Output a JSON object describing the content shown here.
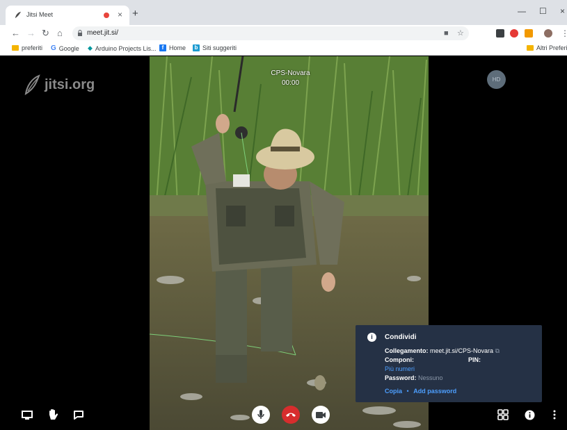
{
  "browser": {
    "tab_title": "Jitsi Meet",
    "close_glyph": "×",
    "new_tab_glyph": "+",
    "window_controls": {
      "minimize": "—",
      "maximize": "☐",
      "close": "×"
    },
    "url": "meet.jit.si/",
    "bookmarks": [
      {
        "label": "preferiti",
        "icon": "folder-icon"
      },
      {
        "label": "Google",
        "icon": "google-icon"
      },
      {
        "label": "Arduino Projects Lis...",
        "icon": "arduino-icon"
      },
      {
        "label": "Home",
        "icon": "facebook-icon"
      },
      {
        "label": "Siti suggeriti",
        "icon": "bing-icon"
      }
    ],
    "other_bookmarks": "Altri Preferiti"
  },
  "meeting": {
    "logo_text": "jitsi.org",
    "room_name": "CPS-Novara",
    "timer": "00:00",
    "hd_label": "HD"
  },
  "info_panel": {
    "title": "Condividi",
    "link_label": "Collegamento:",
    "link_value": "meet.jit.si/CPS-Novara",
    "dial_label": "Componi:",
    "pin_label": "PIN:",
    "more_numbers": "Più numeri",
    "password_label": "Password:",
    "password_value": "Nessuno",
    "copy_label": "Copia",
    "separator": "•",
    "add_password_label": "Add password"
  },
  "colors": {
    "hangup": "#d72d2d",
    "panel_bg": "#253145",
    "link": "#4d9fff"
  }
}
